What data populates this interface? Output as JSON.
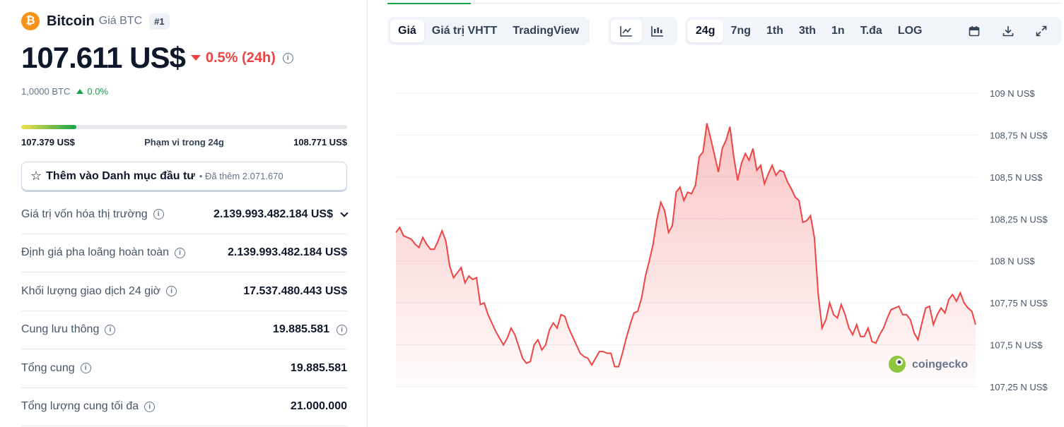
{
  "coin": {
    "logo_symbol": "₿",
    "name": "Bitcoin",
    "sub": "Giá BTC",
    "rank": "#1",
    "price": "107.611 US$",
    "change": "0.5% (24h)",
    "btc_value": "1,0000 BTC",
    "btc_change": "0.0%",
    "accent": "#f7931a"
  },
  "range": {
    "low": "107.379 US$",
    "label": "Phạm vi trong 24g",
    "high": "108.771 US$",
    "position_pct": 17
  },
  "watchlist": {
    "label": "Thêm vào Danh mục đầu tư",
    "sub": "• Đã thêm 2.071.670"
  },
  "stats": [
    {
      "label": "Giá trị vốn hóa thị trường",
      "value": "2.139.993.482.184 US$"
    },
    {
      "label": "Định giá pha loãng hoàn toàn",
      "value": "2.139.993.482.184 US$"
    },
    {
      "label": "Khối lượng giao dịch 24 giờ",
      "value": "17.537.480.443 US$"
    },
    {
      "label": "Cung lưu thông",
      "value": "19.885.581"
    },
    {
      "label": "Tổng cung",
      "value": "19.885.581"
    },
    {
      "label": "Tổng lượng cung tối đa",
      "value": "21.000.000"
    }
  ],
  "toolbar": {
    "view_tabs": [
      "Giá",
      "Giá trị VHTT",
      "TradingView"
    ],
    "range_tabs": [
      "24g",
      "7ng",
      "1th",
      "3th",
      "1n",
      "T.đa",
      "LOG"
    ],
    "icons": [
      "line-chart-icon",
      "candlestick-icon",
      "calendar-icon",
      "download-icon",
      "expand-icon"
    ]
  },
  "watermark": "coingecko",
  "chart_data": {
    "type": "area",
    "title": "",
    "xlabel": "",
    "ylabel": "",
    "ylim": [
      107.25,
      109
    ],
    "y_ticks": [
      109,
      108.75,
      108.5,
      108.25,
      108,
      107.75,
      107.5,
      107.25
    ],
    "y_tick_labels": [
      "109 N US$",
      "108,75 N US$",
      "108,5 N US$",
      "108,25 N US$",
      "108 N US$",
      "107,75 N US$",
      "107,5 N US$",
      "107,25 N US$"
    ],
    "color": "#ef4444",
    "series": [
      {
        "values": [
          108.17,
          108.2,
          108.15,
          108.14,
          108.13,
          108.1,
          108.08,
          108.14,
          108.1,
          108.07,
          108.07,
          108.12,
          108.18,
          108.12,
          107.97,
          107.9,
          107.93,
          107.96,
          107.87,
          107.91,
          107.89,
          107.9,
          107.74,
          107.75,
          107.68,
          107.63,
          107.58,
          107.54,
          107.5,
          107.54,
          107.6,
          107.56,
          107.49,
          107.42,
          107.39,
          107.4,
          107.5,
          107.53,
          107.47,
          107.5,
          107.59,
          107.63,
          107.6,
          107.68,
          107.67,
          107.6,
          107.55,
          107.5,
          107.45,
          107.43,
          107.42,
          107.38,
          107.42,
          107.46,
          107.46,
          107.45,
          107.45,
          107.37,
          107.37,
          107.45,
          107.54,
          107.62,
          107.69,
          107.7,
          107.78,
          107.91,
          108,
          108.1,
          108.25,
          108.35,
          108.3,
          108.17,
          108.21,
          108.41,
          108.44,
          108.36,
          108.41,
          108.4,
          108.45,
          108.62,
          108.65,
          108.82,
          108.73,
          108.63,
          108.53,
          108.67,
          108.72,
          108.8,
          108.62,
          108.48,
          108.58,
          108.64,
          108.6,
          108.67,
          108.54,
          108.57,
          108.46,
          108.52,
          108.57,
          108.51,
          108.54,
          108.53,
          108.47,
          108.43,
          108.38,
          108.36,
          108.23,
          108.24,
          108.27,
          108.14,
          107.8,
          107.6,
          107.65,
          107.75,
          107.68,
          107.66,
          107.74,
          107.68,
          107.6,
          107.56,
          107.62,
          107.55,
          107.55,
          107.6,
          107.52,
          107.51,
          107.56,
          107.6,
          107.66,
          107.71,
          107.72,
          107.73,
          107.68,
          107.68,
          107.65,
          107.57,
          107.53,
          107.63,
          107.72,
          107.73,
          107.62,
          107.68,
          107.72,
          107.69,
          107.77,
          107.8,
          107.76,
          107.81,
          107.75,
          107.72,
          107.7,
          107.62
        ]
      }
    ]
  }
}
